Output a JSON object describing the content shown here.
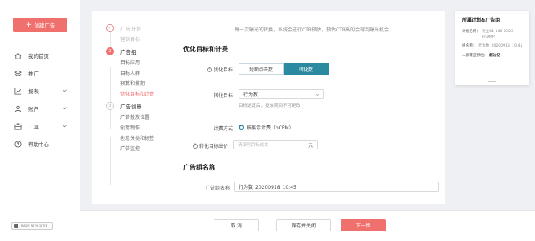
{
  "sidebar": {
    "create_label": "创建广告",
    "items": [
      {
        "label": "我的首页",
        "icon": "home-icon"
      },
      {
        "label": "推广",
        "icon": "layers-icon"
      },
      {
        "label": "报表",
        "icon": "chart-icon"
      },
      {
        "label": "账户",
        "icon": "user-icon"
      },
      {
        "label": "工具",
        "icon": "toolbox-icon"
      },
      {
        "label": "帮助中心",
        "icon": "help-icon"
      }
    ],
    "footer_badge": "MADE WITH GITEE"
  },
  "steps": {
    "step1": {
      "number": "✓",
      "title": "广告计划",
      "subs": [
        "营销目标"
      ]
    },
    "step2": {
      "number": "2",
      "title": "广告组",
      "subs": [
        "目标应用",
        "目标人群",
        "预算和排期",
        "优化目标和计费"
      ]
    },
    "step3": {
      "number": "3",
      "title": "广告创意",
      "subs": [
        "广告投放位置",
        "创意制作",
        "创意分类和标签",
        "广告监控"
      ]
    }
  },
  "form": {
    "hint": "每一次曝光的转换，系统会进行CTR预估，预估CTR高的会得到曝光机会",
    "section1_title": "优化目标和计费",
    "opt_target_label": "优化目标",
    "opt_target_options": [
      "封面点击数",
      "转化数"
    ],
    "conv_target_label": "转化目标",
    "conv_target_value": "行为数",
    "conv_help": "目标选定后，投放期间不可更改",
    "billing_label": "计费方式",
    "billing_value": "按展示计费（oCPM）",
    "bid_label": "转化目标出价",
    "bid_placeholder": "请填写目标成本",
    "bid_unit": "元",
    "section2_title": "广告组名称",
    "group_name_label": "广告组名称",
    "group_name_value": "行为数_20200918_10:45"
  },
  "actions": {
    "cancel": "取 消",
    "save_close": "保存并关闭",
    "next": "下一步"
  },
  "panel": {
    "title": "所属计划&广告组",
    "plan_name_label": "计划名称：",
    "plan_name_value": "行业01-100-0303-FTDMP",
    "group_name_label": "组名称：",
    "group_name_value": "行为数_20200918_10:45",
    "budget_label": "人群覆盖预估：",
    "budget_value": "超过亿"
  },
  "colors": {
    "accent": "#f0706e",
    "primary_teal": "#2c8aa0"
  }
}
